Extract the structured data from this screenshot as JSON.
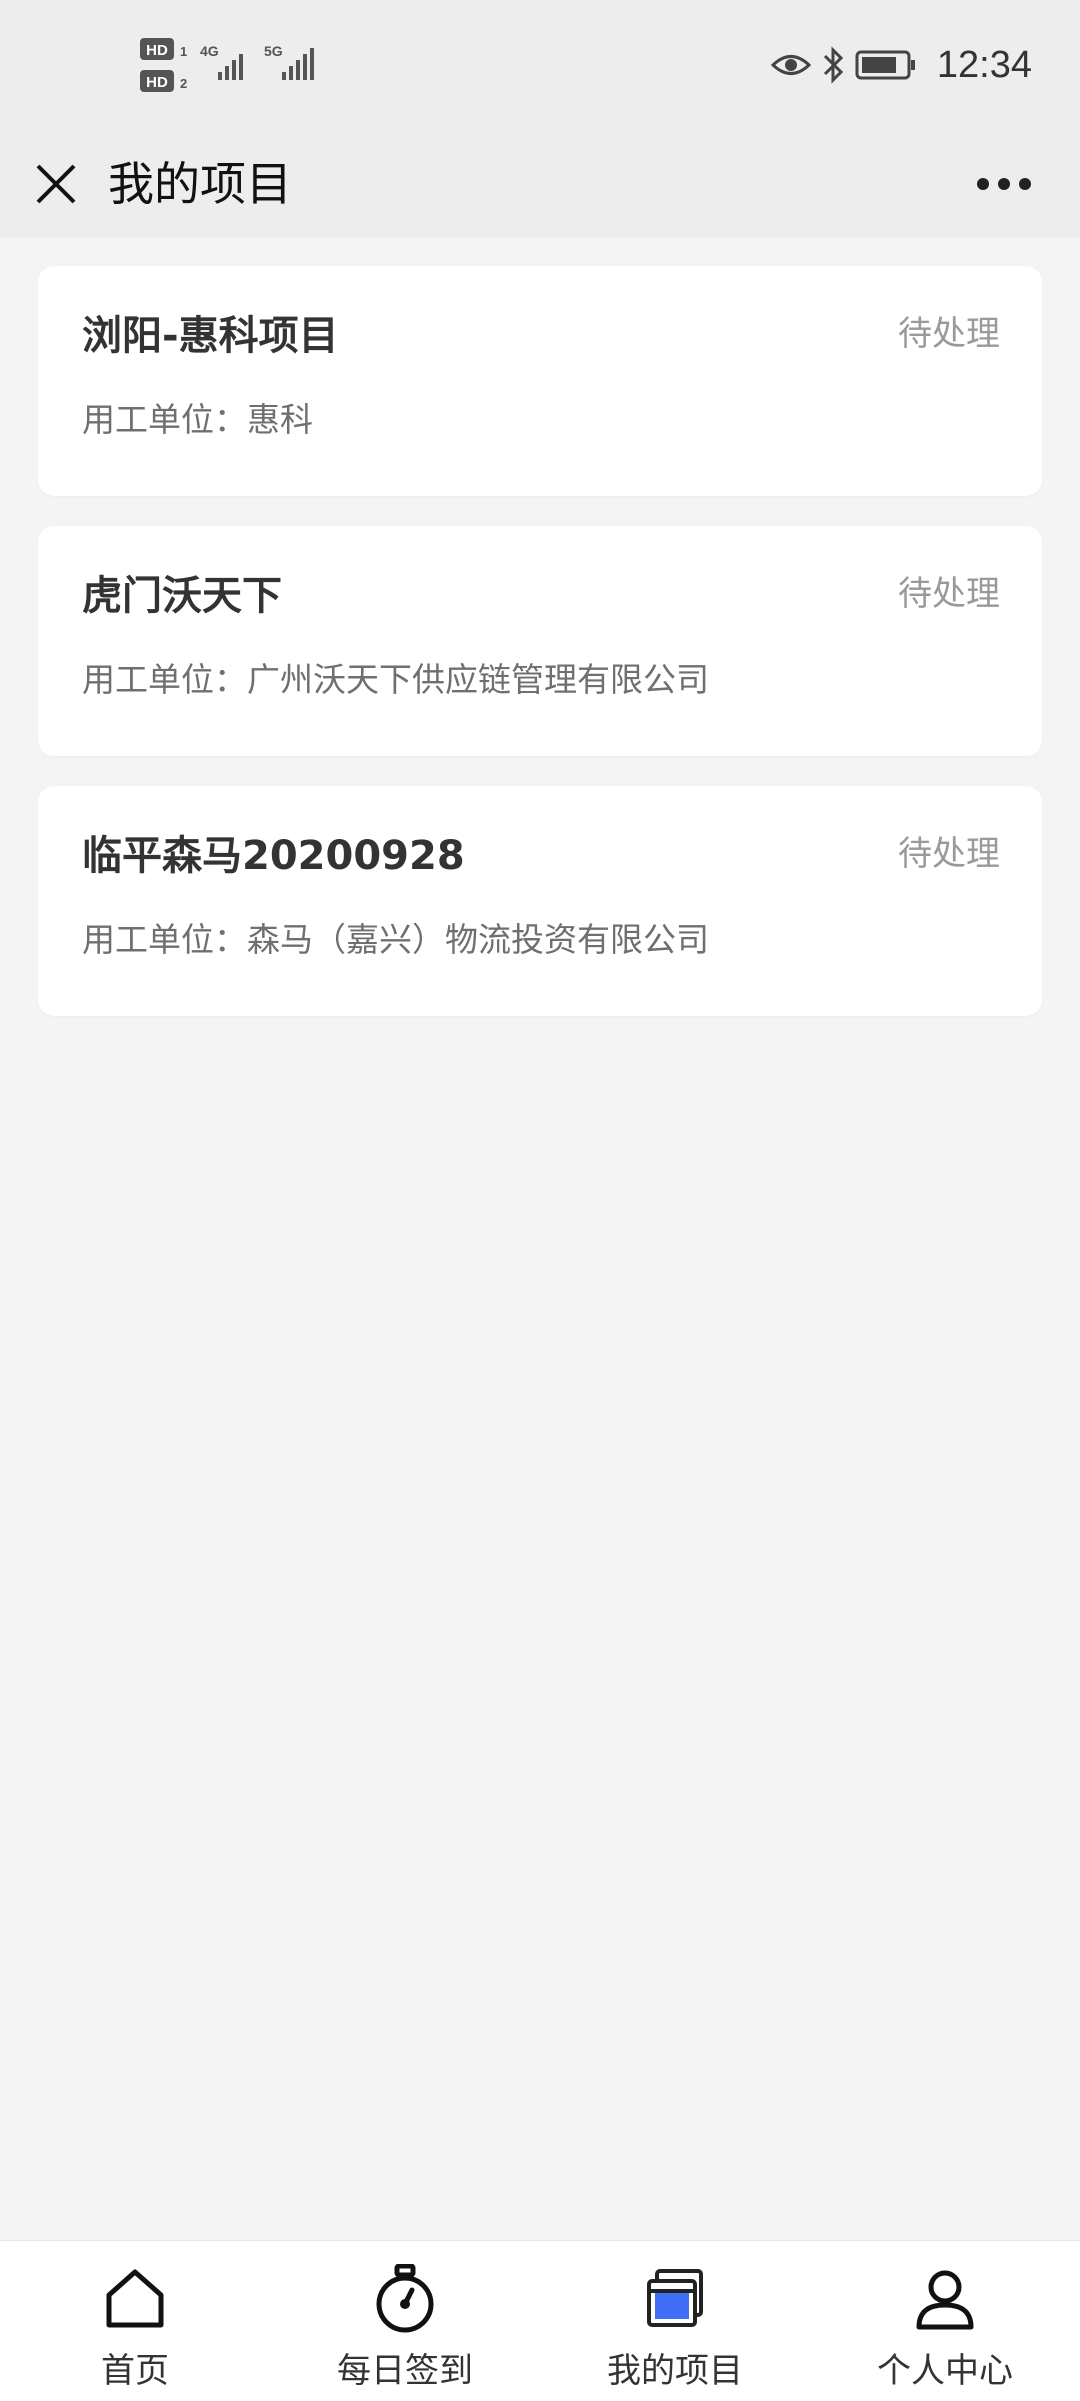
{
  "status_bar": {
    "time": "12:34",
    "sim1_label": "HD",
    "sim1_index": "1",
    "sim2_label": "HD",
    "sim2_index": "2",
    "network1": "4G",
    "network2": "5G",
    "icons": [
      "eye-icon",
      "bluetooth-icon",
      "battery-icon"
    ]
  },
  "nav": {
    "title": "我的项目",
    "close_icon": "close-icon",
    "more_icon": "more-icon"
  },
  "projects": [
    {
      "title": "浏阳-惠科项目",
      "status": "待处理",
      "company": "用工单位：惠科"
    },
    {
      "title": "虎门沃天下",
      "status": "待处理",
      "company": "用工单位：广州沃天下供应链管理有限公司"
    },
    {
      "title": "临平森马20200928",
      "status": "待处理",
      "company": "用工单位：森马（嘉兴）物流投资有限公司"
    }
  ],
  "tabs": [
    {
      "label": "首页",
      "icon": "home-icon"
    },
    {
      "label": "每日签到",
      "icon": "stopwatch-icon"
    },
    {
      "label": "我的项目",
      "icon": "projects-icon"
    },
    {
      "label": "个人中心",
      "icon": "user-icon"
    }
  ],
  "colors": {
    "accent": "#3d6ef5",
    "header_bg": "#ededed",
    "page_bg": "#f4f4f4",
    "status_text": "#999999"
  }
}
